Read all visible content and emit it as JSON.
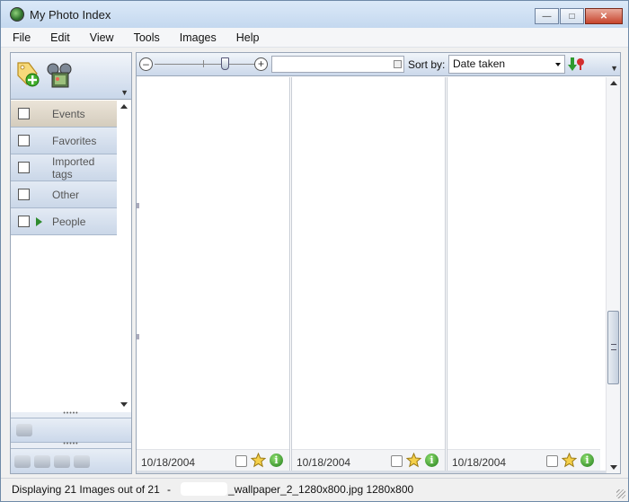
{
  "window": {
    "title": "My Photo Index"
  },
  "menu": [
    "File",
    "Edit",
    "View",
    "Tools",
    "Images",
    "Help"
  ],
  "tags": [
    {
      "label": "Events",
      "selected": true,
      "expandable": false
    },
    {
      "label": "Favorites",
      "selected": false,
      "expandable": false
    },
    {
      "label": "Imported tags",
      "selected": false,
      "expandable": false
    },
    {
      "label": "Other",
      "selected": false,
      "expandable": false
    },
    {
      "label": "People",
      "selected": false,
      "expandable": true
    }
  ],
  "toolbar": {
    "sort_label": "Sort by:",
    "sort_value": "Date taken",
    "search_value": "",
    "zoom_level": 0.7
  },
  "thumbnails": [
    {
      "date": "10/18/2004"
    },
    {
      "date": "10/18/2004"
    },
    {
      "date": "10/18/2004"
    }
  ],
  "status": {
    "summary": "Displaying 21 Images out of 21",
    "separator": "-",
    "file": "_wallpaper_2_1280x800.jpg 1280x800"
  },
  "colors": {
    "accent_green": "#2e8b2e",
    "panel_blue": "#cad7e8",
    "selected_tag": "#d4ccbd"
  },
  "icons": {
    "add_tag": "add-tag-icon",
    "find": "binoculars-icon",
    "star": "star-icon",
    "info": "info-icon",
    "sort_direction": "sort-direction-icon"
  }
}
